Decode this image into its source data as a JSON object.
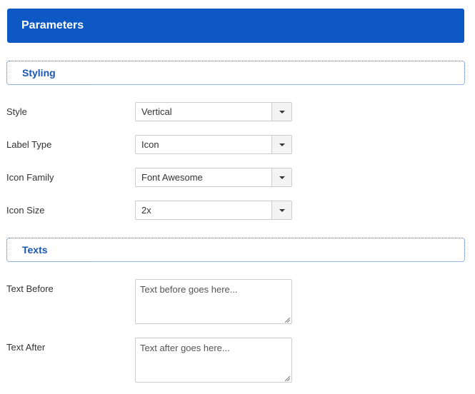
{
  "header": {
    "title": "Parameters"
  },
  "sections": {
    "styling": {
      "title": "Styling"
    },
    "texts": {
      "title": "Texts"
    }
  },
  "fields": {
    "style": {
      "label": "Style",
      "value": "Vertical"
    },
    "label_type": {
      "label": "Label Type",
      "value": "Icon"
    },
    "icon_family": {
      "label": "Icon Family",
      "value": "Font Awesome"
    },
    "icon_size": {
      "label": "Icon Size",
      "value": "2x"
    },
    "text_before": {
      "label": "Text Before",
      "placeholder": "Text before goes here..."
    },
    "text_after": {
      "label": "Text After",
      "placeholder": "Text after goes here..."
    }
  },
  "colors": {
    "header_bg": "#0e58c4",
    "section_title": "#1a56b0",
    "section_border": "#2a66c6"
  }
}
